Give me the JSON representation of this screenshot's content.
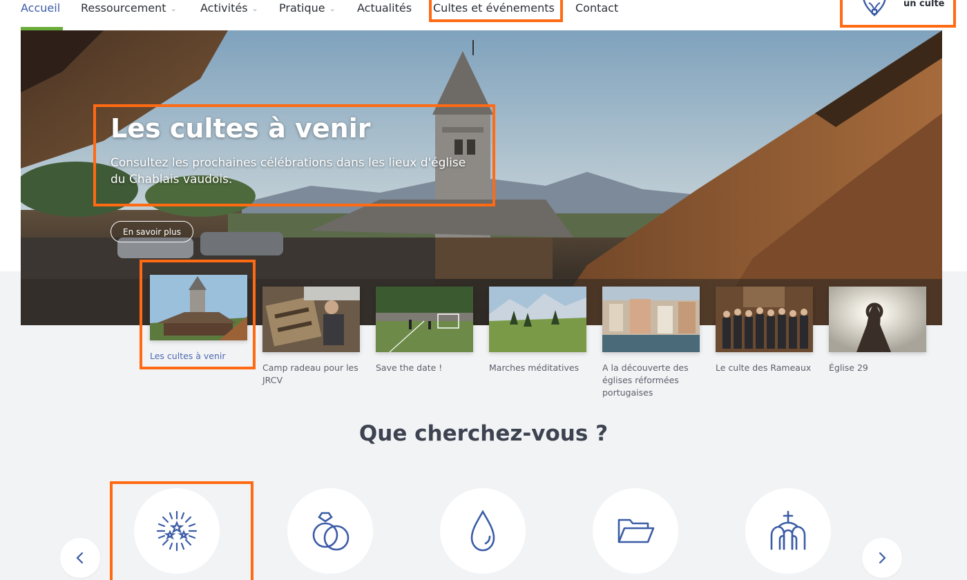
{
  "nav": {
    "items": [
      {
        "label": "Accueil",
        "active": true
      },
      {
        "label": "Ressourcement",
        "dropdown": true
      },
      {
        "label": "Activités",
        "dropdown": true
      },
      {
        "label": "Pratique",
        "dropdown": true
      },
      {
        "label": "Actualités"
      },
      {
        "label": "Cultes et événements"
      },
      {
        "label": "Contact"
      }
    ],
    "find_cult_label": "un culte",
    "find_cult_icon": "map-pin-icon"
  },
  "hero": {
    "title": "Les cultes à venir",
    "description": "Consultez les prochaines célébrations dans les lieux d'église du Chablais vaudois.",
    "button_label": "En savoir plus"
  },
  "slides": [
    {
      "caption": "Les cultes à venir",
      "active": true
    },
    {
      "caption": "Camp radeau pour les JRCV"
    },
    {
      "caption": "Save the date !"
    },
    {
      "caption": "Marches méditatives"
    },
    {
      "caption": "A la découverte des églises réformées portugaises"
    },
    {
      "caption": "Le culte des Rameaux"
    },
    {
      "caption": "Église 29"
    }
  ],
  "search": {
    "title": "Que cherchez-vous ?",
    "categories": [
      {
        "icon": "sparkle-stars-icon"
      },
      {
        "icon": "wedding-rings-icon"
      },
      {
        "icon": "water-drop-icon"
      },
      {
        "icon": "folder-open-icon"
      },
      {
        "icon": "church-icon"
      }
    ],
    "prev_icon": "chevron-left-icon",
    "next_icon": "chevron-right-icon"
  },
  "colors": {
    "accent_blue": "#3a5ba6",
    "active_green": "#6aac3a",
    "highlight_orange": "#ff6a13",
    "band_grey": "#f2f3f5"
  }
}
